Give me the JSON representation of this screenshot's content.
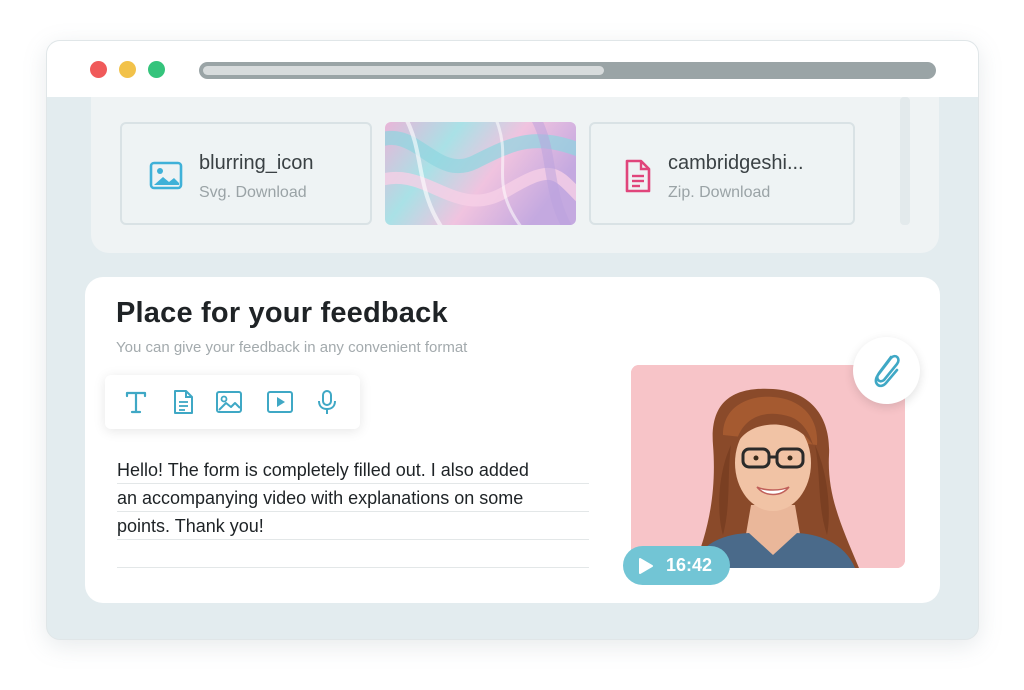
{
  "window": {
    "controls": [
      "close",
      "minimize",
      "maximize"
    ],
    "address_bar_progress": 0.55
  },
  "files": [
    {
      "name": "blurring_icon",
      "meta": "Svg. Download",
      "icon": "image-icon",
      "color": "#3fb1d8"
    },
    {
      "name": "marble-image-preview",
      "icon": "image-thumbnail"
    },
    {
      "name": "cambridgeshi...",
      "meta": "Zip. Download",
      "icon": "document-icon",
      "color": "#e0457b"
    }
  ],
  "feedback": {
    "title": "Place for your feedback",
    "subtitle": "You can give your feedback in any convenient format",
    "tools": [
      "text-icon",
      "document-icon",
      "image-icon",
      "video-icon",
      "microphone-icon"
    ],
    "message_lines": [
      "Hello! The form is completely filled out. I also added",
      "an accompanying video with explanations on some",
      "points. Thank you!",
      ""
    ],
    "video": {
      "duration": "16:42",
      "background": "#f7c4c8"
    },
    "attach_icon": "paperclip-icon",
    "accent": "#3fa8c5"
  }
}
